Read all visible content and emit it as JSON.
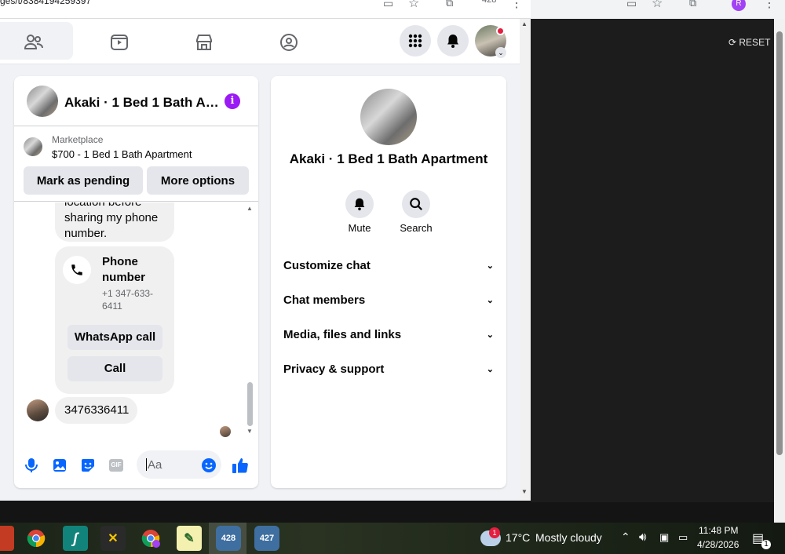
{
  "browser": {
    "url_fragment": "ges/t/8384194259397",
    "tab_count": "428"
  },
  "background_window": {
    "reset_label": "RESET"
  },
  "chat": {
    "title": "Akaki · 1 Bed 1 Bath A…",
    "marketplace_label": "Marketplace",
    "listing": "$700 - 1 Bed 1 Bath Apartment",
    "mark_pending_label": "Mark as pending",
    "more_options_label": "More options",
    "partial_message": "location before sharing my phone number.",
    "phone_card": {
      "title": "Phone number",
      "number": "+1 347-633-6411",
      "whatsapp_label": "WhatsApp call",
      "call_label": "Call"
    },
    "last_message": "3476336411",
    "composer_placeholder": "Aa"
  },
  "info_panel": {
    "title": "Akaki · 1 Bed 1 Bath Apartment",
    "mute_label": "Mute",
    "search_label": "Search",
    "sections": [
      "Customize chat",
      "Chat members",
      "Media, files and links",
      "Privacy & support"
    ]
  },
  "taskbar": {
    "weather_temp": "17°C",
    "weather_text": "Mostly cloudy",
    "weather_badge": "1",
    "time": "11:48 PM",
    "date": "4/28/2026",
    "app_428": "428",
    "app_427": "427",
    "notification_count": "1"
  },
  "colors": {
    "messenger_blue": "#0866ff",
    "info_purple": "#9b19f5",
    "notification_red": "#e41e3f"
  }
}
